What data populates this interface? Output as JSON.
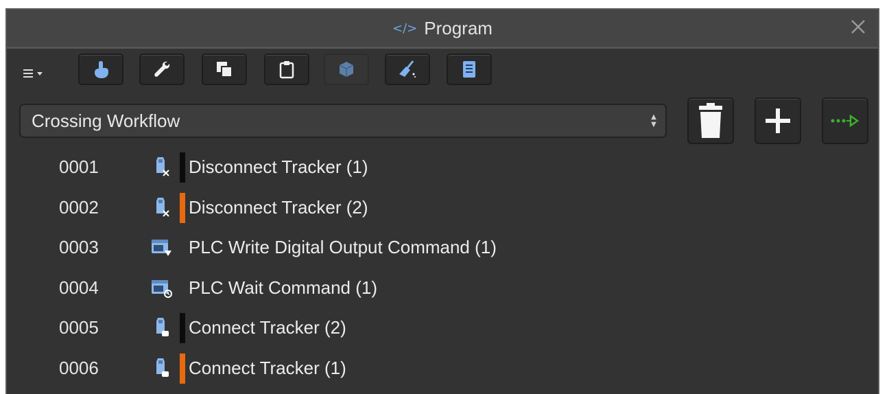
{
  "window": {
    "title": "Program",
    "title_icon": "code-icon"
  },
  "toolbar": {
    "menu_icon": "hamburger-dropdown-icon",
    "buttons": [
      {
        "name": "hand-pointer-icon",
        "enabled": true
      },
      {
        "name": "wrench-icon",
        "enabled": true
      },
      {
        "name": "copy-icon",
        "enabled": true
      },
      {
        "name": "clipboard-icon",
        "enabled": true
      },
      {
        "name": "cube-icon",
        "enabled": false
      },
      {
        "name": "broom-icon",
        "enabled": true
      },
      {
        "name": "list-icon",
        "enabled": true
      }
    ]
  },
  "program": {
    "selected": "Crossing Workflow",
    "delete_icon": "trash-icon",
    "add_icon": "plus-icon",
    "run_icon": "run-sequence-icon"
  },
  "steps": [
    {
      "number": "0001",
      "label": "Disconnect Tracker (1)",
      "icon": "tracker-disconnect-icon",
      "marker": "#0c0c0c"
    },
    {
      "number": "0002",
      "label": "Disconnect Tracker (2)",
      "icon": "tracker-disconnect-icon",
      "marker": "#e8690f"
    },
    {
      "number": "0003",
      "label": "PLC Write Digital Output Command (1)",
      "icon": "plc-write-icon",
      "marker": null
    },
    {
      "number": "0004",
      "label": "PLC Wait Command (1)",
      "icon": "plc-wait-icon",
      "marker": null
    },
    {
      "number": "0005",
      "label": "Connect Tracker (2)",
      "icon": "tracker-connect-icon",
      "marker": "#0c0c0c"
    },
    {
      "number": "0006",
      "label": "Connect Tracker (1)",
      "icon": "tracker-connect-icon",
      "marker": "#e8690f"
    }
  ],
  "colors": {
    "accent_blue": "#6ea6e6",
    "marker_orange": "#e8690f",
    "marker_black": "#0c0c0c",
    "run_green": "#3fae2f"
  }
}
